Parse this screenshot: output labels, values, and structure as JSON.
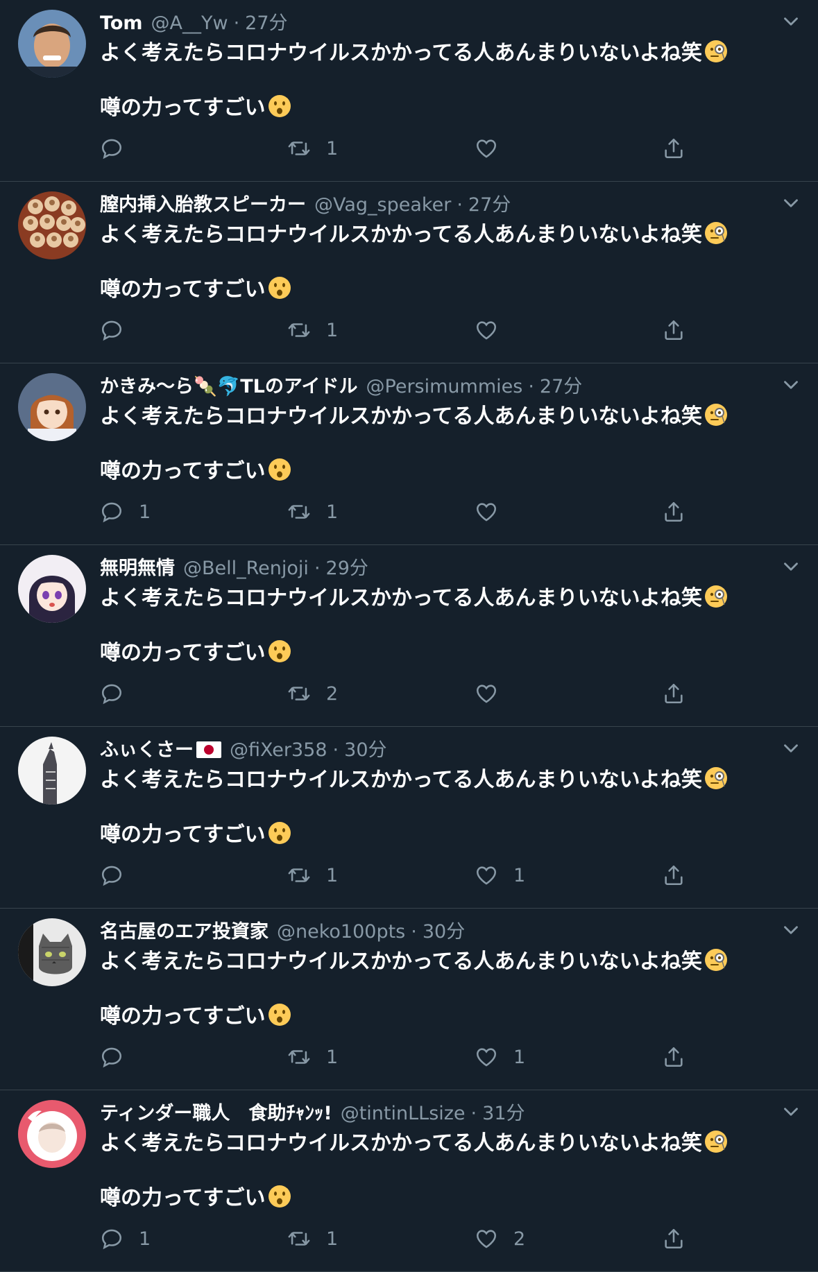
{
  "colors": {
    "background": "#15202b",
    "divider": "#38444d",
    "muted": "#8899a6",
    "text": "#ffffff"
  },
  "tweets": [
    {
      "name": "Tom",
      "handle": "@A__Yw",
      "sep": "·",
      "time": "27分",
      "line1": "よく考えたらコロナウイルスかかってる人あんまりいないよね笑",
      "line2": "噂の力ってすごい",
      "emoji1": "face-with-monocle",
      "emoji2": "hushed-face",
      "reply": "",
      "retweet": "1",
      "like": "",
      "avatar": {
        "kind": "photo-face",
        "bg": "#6a8fb8",
        "fg": "#d9a57e"
      }
    },
    {
      "name": "膣内挿入胎教スピーカー",
      "handle": "@Vag_speaker",
      "sep": "·",
      "time": "27分",
      "line1": "よく考えたらコロナウイルスかかってる人あんまりいないよね笑",
      "line2": "噂の力ってすごい",
      "emoji1": "face-with-monocle",
      "emoji2": "hushed-face",
      "reply": "",
      "retweet": "1",
      "like": "",
      "avatar": {
        "kind": "dumplings",
        "bg": "#8a3b22",
        "fg": "#e8c9a4"
      }
    },
    {
      "name": "かきみ〜ら🍡🐬TLのアイドル",
      "handle": "@Persimummies",
      "sep": "·",
      "time": "27分",
      "line1": "よく考えたらコロナウイルスかかってる人あんまりいないよね笑",
      "line2": "噂の力ってすごい",
      "emoji1": "face-with-monocle",
      "emoji2": "hushed-face",
      "reply": "1",
      "retweet": "1",
      "like": "",
      "avatar": {
        "kind": "anime-brown",
        "bg": "#5b6e8a",
        "fg": "#b4612d"
      }
    },
    {
      "name": "無明無情",
      "handle": "@Bell_Renjoji",
      "sep": "·",
      "time": "29分",
      "line1": "よく考えたらコロナウイルスかかってる人あんまりいないよね笑",
      "line2": "噂の力ってすごい",
      "emoji1": "face-with-monocle",
      "emoji2": "hushed-face",
      "reply": "",
      "retweet": "2",
      "like": "",
      "avatar": {
        "kind": "anime-dark",
        "bg": "#f2eef4",
        "fg": "#2b2440"
      }
    },
    {
      "name": "ふぃくさー",
      "flag": "japan-flag",
      "handle": "@fiXer358",
      "sep": "·",
      "time": "30分",
      "line1": "よく考えたらコロナウイルスかかってる人あんまりいないよね笑",
      "line2": "噂の力ってすごい",
      "emoji1": "face-with-monocle",
      "emoji2": "hushed-face",
      "reply": "",
      "retweet": "1",
      "like": "1",
      "avatar": {
        "kind": "tower",
        "bg": "#f4f4f4",
        "fg": "#4a4a52"
      }
    },
    {
      "name": "名古屋のエア投資家",
      "handle": "@neko100pts",
      "sep": "·",
      "time": "30分",
      "line1": "よく考えたらコロナウイルスかかってる人あんまりいないよね笑",
      "line2": "噂の力ってすごい",
      "emoji1": "face-with-monocle",
      "emoji2": "hushed-face",
      "reply": "",
      "retweet": "1",
      "like": "1",
      "avatar": {
        "kind": "cat",
        "bg": "#e9e9e9",
        "fg": "#5c5c5c"
      }
    },
    {
      "name": "ティンダー職人　食助ﾁｬﾝｯ!",
      "handle": "@tintinLLsize",
      "sep": "·",
      "time": "31分",
      "line1": "よく考えたらコロナウイルスかかってる人あんまりいないよね笑",
      "line2": "噂の力ってすごい",
      "emoji1": "face-with-monocle",
      "emoji2": "hushed-face",
      "reply": "1",
      "retweet": "1",
      "like": "2",
      "avatar": {
        "kind": "portrait-pink",
        "bg": "#e85a6e",
        "fg": "#f6e6dc"
      }
    }
  ]
}
